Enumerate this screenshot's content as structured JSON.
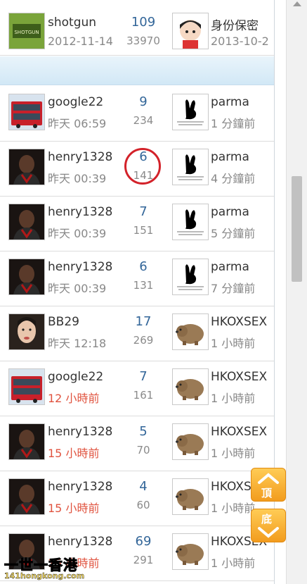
{
  "top_row": {
    "author": "shotgun",
    "date": "2012-11-14",
    "replies": "109",
    "views": "33970",
    "last_user": "身份保密",
    "last_time": "2013-10-2"
  },
  "rows": [
    {
      "author": "google22",
      "date": "昨天 06:59",
      "date_hot": false,
      "replies": "9",
      "views": "234",
      "last_user": "parma",
      "last_time": "1 分鐘前",
      "avatar": "bus-icon",
      "last_avatar": "bunny-logo-icon"
    },
    {
      "author": "henry1328",
      "date": "昨天 00:39",
      "date_hot": false,
      "replies": "6",
      "views": "141",
      "last_user": "parma",
      "last_time": "4 分鐘前",
      "avatar": "person-icon",
      "last_avatar": "bunny-logo-icon"
    },
    {
      "author": "henry1328",
      "date": "昨天 00:39",
      "date_hot": false,
      "replies": "7",
      "views": "151",
      "last_user": "parma",
      "last_time": "5 分鐘前",
      "avatar": "person-icon",
      "last_avatar": "bunny-logo-icon"
    },
    {
      "author": "henry1328",
      "date": "昨天 00:39",
      "date_hot": false,
      "replies": "6",
      "views": "131",
      "last_user": "parma",
      "last_time": "7 分鐘前",
      "avatar": "person-icon",
      "last_avatar": "bunny-logo-icon"
    },
    {
      "author": "BB29",
      "date": "昨天 12:18",
      "date_hot": false,
      "replies": "17",
      "views": "269",
      "last_user": "HKOXSEX",
      "last_time": "1 小時前",
      "avatar": "woman-icon",
      "last_avatar": "wombat-icon"
    },
    {
      "author": "google22",
      "date": "12 小時前",
      "date_hot": true,
      "replies": "7",
      "views": "161",
      "last_user": "HKOXSEX",
      "last_time": "1 小時前",
      "avatar": "bus-icon",
      "last_avatar": "wombat-icon"
    },
    {
      "author": "henry1328",
      "date": "15 小時前",
      "date_hot": true,
      "replies": "5",
      "views": "70",
      "last_user": "HKOXSEX",
      "last_time": "1 小時前",
      "avatar": "person-icon",
      "last_avatar": "wombat-icon"
    },
    {
      "author": "henry1328",
      "date": "15 小時前",
      "date_hot": true,
      "replies": "4",
      "views": "60",
      "last_user": "HKOXSEX",
      "last_time": "1 小時前",
      "avatar": "person-icon",
      "last_avatar": "wombat-icon"
    },
    {
      "author": "henry1328",
      "date": "15 小時前",
      "date_hot": true,
      "replies": "69",
      "views": "291",
      "last_user": "HKOXSEX",
      "last_time": "1 小時前",
      "avatar": "person-icon",
      "last_avatar": "wombat-icon"
    }
  ],
  "nav": {
    "top_label": "頂",
    "bottom_label": "底"
  },
  "logo": {
    "text": "一世一香港",
    "url": "141hongkong.com"
  },
  "colors": {
    "reply_count": "#336699",
    "hot_date": "#e0533f",
    "highlight_circle": "#d3222a",
    "nav_button": "#f29c1e"
  }
}
